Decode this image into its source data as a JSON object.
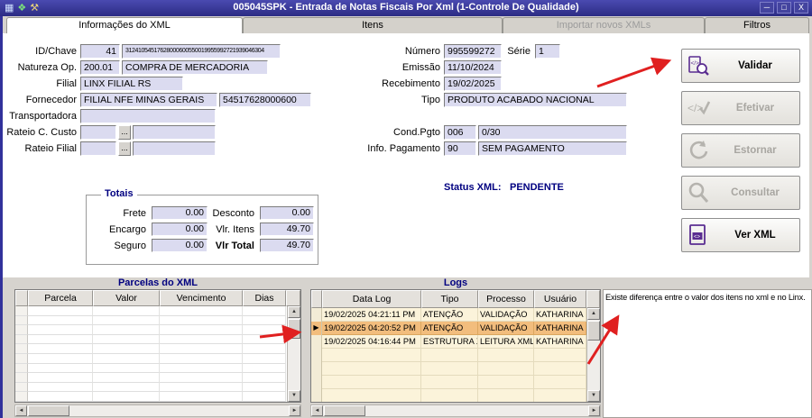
{
  "window": {
    "title": "005045SPK - Entrada de Notas Fiscais Por Xml (1-Controle De Qualidade)",
    "minimize": "─",
    "maximize": "□",
    "close": "X"
  },
  "titlebar_icons": {
    "grid": "▦",
    "app": "❖",
    "wrench": "⚒"
  },
  "tabs": {
    "informacoes": "Informações do XML",
    "itens": "Itens",
    "importar": "Importar novos XMLs",
    "filtros": "Filtros"
  },
  "form": {
    "id_chave": {
      "label": "ID/Chave",
      "id": "41",
      "chave": "31241054517628000600550019955992721939046304"
    },
    "natureza": {
      "label": "Natureza Op.",
      "code": "200.01",
      "desc": "COMPRA DE MERCADORIA"
    },
    "filial": {
      "label": "Filial",
      "value": "LINX FILIAL RS"
    },
    "fornecedor": {
      "label": "Fornecedor",
      "name": "FILIAL NFE MINAS GERAIS",
      "cnpj": "54517628000600"
    },
    "transportadora": {
      "label": "Transportadora",
      "value": ""
    },
    "rateio_c_custo": {
      "label": "Rateio C. Custo",
      "code": "",
      "dots": "...",
      "desc": ""
    },
    "rateio_filial": {
      "label": "Rateio Filial",
      "code": "",
      "dots": "...",
      "desc": ""
    },
    "numero": {
      "label": "Número",
      "value": "995599272"
    },
    "serie": {
      "label": "Série",
      "value": "1"
    },
    "emissao": {
      "label": "Emissão",
      "value": "11/10/2024"
    },
    "recebimento": {
      "label": "Recebimento",
      "value": "19/02/2025"
    },
    "tipo": {
      "label": "Tipo",
      "value": "PRODUTO ACABADO NACIONAL"
    },
    "cond_pgto": {
      "label": "Cond.Pgto",
      "code": "006",
      "desc": "0/30"
    },
    "info_pagamento": {
      "label": "Info. Pagamento",
      "code": "90",
      "desc": "SEM PAGAMENTO"
    },
    "status_xml": {
      "label": "Status XML:",
      "value": "PENDENTE"
    }
  },
  "totais": {
    "title": "Totais",
    "frete": {
      "label": "Frete",
      "value": "0.00"
    },
    "encargo": {
      "label": "Encargo",
      "value": "0.00"
    },
    "seguro": {
      "label": "Seguro",
      "value": "0.00"
    },
    "desconto": {
      "label": "Desconto",
      "value": "0.00"
    },
    "vlr_itens": {
      "label": "Vlr. Itens",
      "value": "49.70"
    },
    "vlr_total": {
      "label": "Vlr Total",
      "value": "49.70"
    }
  },
  "actions": {
    "validar": "Validar",
    "efetivar": "Efetivar",
    "estornar": "Estornar",
    "consultar": "Consultar",
    "ver_xml": "Ver XML"
  },
  "parcelas": {
    "title": "Parcelas do XML",
    "columns": [
      "Parcela",
      "Valor",
      "Vencimento",
      "Dias"
    ]
  },
  "logs": {
    "title": "Logs",
    "columns": [
      "Data Log",
      "Tipo",
      "Processo",
      "Usuário"
    ],
    "row_indicator": "▶",
    "rows": [
      {
        "data_log": "19/02/2025 04:21:11 PM",
        "tipo": "ATENÇÃO",
        "processo": "VALIDAÇÃO",
        "usuario": "KATHARINA"
      },
      {
        "data_log": "19/02/2025 04:20:52 PM",
        "tipo": "ATENÇÃO",
        "processo": "VALIDAÇÃO",
        "usuario": "KATHARINA"
      },
      {
        "data_log": "19/02/2025 04:16:44 PM",
        "tipo": "ESTRUTURA XML OK",
        "processo": "LEITURA XML",
        "usuario": "KATHARINA"
      }
    ]
  },
  "message": "Existe diferença entre o valor dos itens no xml e no Linx.",
  "scroll": {
    "up": "▲",
    "down": "▼",
    "left": "◄",
    "right": "►"
  },
  "colors": {
    "titlebar": "#31319b",
    "accent_icon": "#5a2d91",
    "status_text": "#000080",
    "selected_row": "#f2bd7d",
    "field_bg": "#dbdbf0"
  }
}
